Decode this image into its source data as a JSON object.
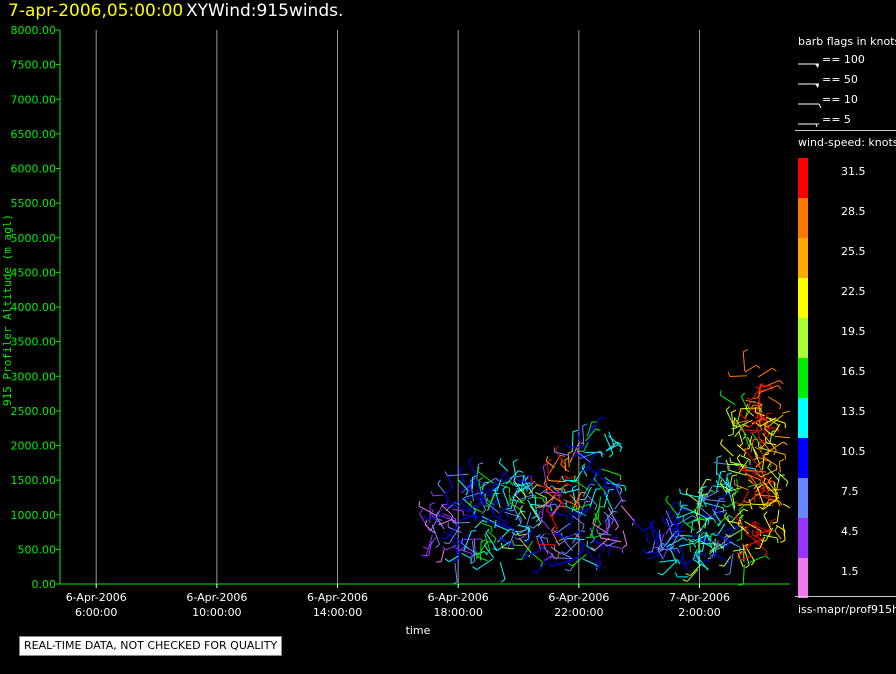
{
  "header": {
    "time": "7-apr-2006,05:00:00",
    "title": "XYWind:915winds."
  },
  "colors": {
    "background": "#000000",
    "axis": "#00ee00",
    "time": "#ffff00"
  },
  "chart_data": {
    "type": "scatter",
    "title": "XYWind:915winds.",
    "xlabel": "time",
    "ylabel": "915 Profiler Altitude (m agl)",
    "ylim": [
      0,
      8000
    ],
    "xlim_hours": [
      4.8,
      29.0
    ],
    "grid": true,
    "yticks": [
      "0.00",
      "500.00",
      "1000.00",
      "1500.00",
      "2000.00",
      "2500.00",
      "3000.00",
      "3500.00",
      "4000.00",
      "4500.00",
      "5000.00",
      "5500.00",
      "6000.00",
      "6500.00",
      "7000.00",
      "7500.00",
      "8000.00"
    ],
    "xticks": [
      {
        "date": "6-Apr-2006",
        "time": "6:00:00",
        "hour": 6
      },
      {
        "date": "6-Apr-2006",
        "time": "10:00:00",
        "hour": 10
      },
      {
        "date": "6-Apr-2006",
        "time": "14:00:00",
        "hour": 14
      },
      {
        "date": "6-Apr-2006",
        "time": "18:00:00",
        "hour": 18
      },
      {
        "date": "6-Apr-2006",
        "time": "22:00:00",
        "hour": 22
      },
      {
        "date": "7-Apr-2006",
        "time": "2:00:00",
        "hour": 26
      }
    ],
    "observations": [
      {
        "hour": 17.2,
        "alt_min": 500,
        "alt_max": 1200,
        "speed": 4.5
      },
      {
        "hour": 17.8,
        "alt_min": 300,
        "alt_max": 1400,
        "speed": 7.5
      },
      {
        "hour": 18.4,
        "alt_min": 400,
        "alt_max": 1600,
        "speed": 10.5
      },
      {
        "hour": 19.0,
        "alt_min": 300,
        "alt_max": 1500,
        "speed": 13.5
      },
      {
        "hour": 19.6,
        "alt_min": 500,
        "alt_max": 1700,
        "speed": 10.5
      },
      {
        "hour": 20.2,
        "alt_min": 400,
        "alt_max": 1600,
        "speed": 16.5
      },
      {
        "hour": 20.8,
        "alt_min": 300,
        "alt_max": 1500,
        "speed": 7.5
      },
      {
        "hour": 21.4,
        "alt_min": 500,
        "alt_max": 1800,
        "speed": 28.5
      },
      {
        "hour": 22.0,
        "alt_min": 300,
        "alt_max": 2100,
        "speed": 10.5
      },
      {
        "hour": 22.6,
        "alt_min": 400,
        "alt_max": 2200,
        "speed": 13.5
      },
      {
        "hour": 23.2,
        "alt_min": 500,
        "alt_max": 1200,
        "speed": 4.5
      },
      {
        "hour": 24.5,
        "alt_min": 300,
        "alt_max": 900,
        "speed": 7.5
      },
      {
        "hour": 25.0,
        "alt_min": 200,
        "alt_max": 1100,
        "speed": 10.5
      },
      {
        "hour": 25.6,
        "alt_min": 100,
        "alt_max": 1200,
        "speed": 13.5
      },
      {
        "hour": 26.2,
        "alt_min": 200,
        "alt_max": 1400,
        "speed": 16.5
      },
      {
        "hour": 26.8,
        "alt_min": 300,
        "alt_max": 1800,
        "speed": 10.5
      },
      {
        "hour": 27.4,
        "alt_min": 200,
        "alt_max": 2600,
        "speed": 19.5
      },
      {
        "hour": 27.9,
        "alt_min": 400,
        "alt_max": 3300,
        "speed": 31.5
      },
      {
        "hour": 28.4,
        "alt_min": 600,
        "alt_max": 2500,
        "speed": 22.5
      }
    ]
  },
  "legend": {
    "barb_title": "barb flags in knots",
    "barbs": [
      {
        "label": "== 100",
        "kind": "pennant"
      },
      {
        "label": "== 50",
        "kind": "pennant"
      },
      {
        "label": "== 10",
        "kind": "full"
      },
      {
        "label": "== 5",
        "kind": "half"
      }
    ],
    "speed_title": "wind-speed: knots",
    "speeds": [
      {
        "label": "31.5",
        "color": "#ff0000"
      },
      {
        "label": "28.5",
        "color": "#ff7700"
      },
      {
        "label": "25.5",
        "color": "#ffaa00"
      },
      {
        "label": "22.5",
        "color": "#ffff00"
      },
      {
        "label": "19.5",
        "color": "#aaff33"
      },
      {
        "label": "16.5",
        "color": "#00ee00"
      },
      {
        "label": "13.5",
        "color": "#00ffff"
      },
      {
        "label": "10.5",
        "color": "#0000ff"
      },
      {
        "label": "7.5",
        "color": "#6688ff"
      },
      {
        "label": "4.5",
        "color": "#9933ff"
      },
      {
        "label": "1.5",
        "color": "#ee77ee"
      }
    ],
    "source": "iss-mapr/prof915h"
  },
  "footer": {
    "disclaimer": "REAL-TIME DATA, NOT CHECKED FOR QUALITY"
  }
}
